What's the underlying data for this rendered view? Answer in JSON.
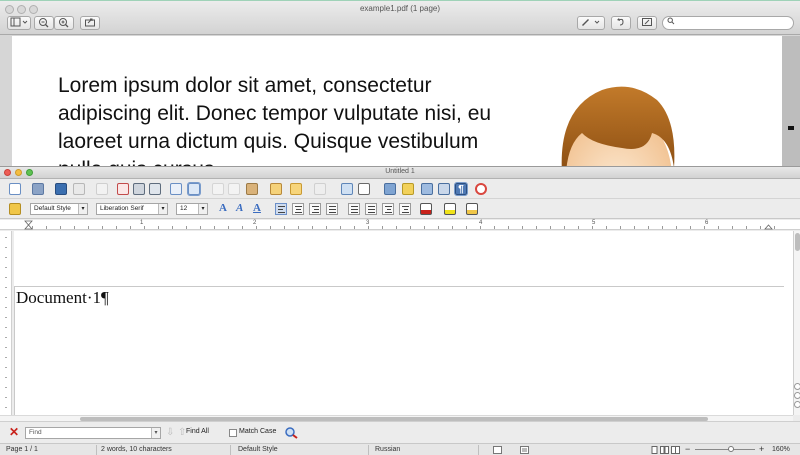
{
  "preview": {
    "title": "example1.pdf (1 page)",
    "search_placeholder": "",
    "body_text": "Lorem ipsum dolor sit amet, consectetur adipiscing elit. Donec tempor vulputate nisi, eu laoreet urna dictum quis. Quisque vestibulum nulla quis cursus"
  },
  "writer": {
    "title": "Untitled 1",
    "style_box": "Default Style",
    "font_box": "Liberation Serif",
    "size_box": "12",
    "ruler_numbers": [
      "1",
      "2",
      "3",
      "4",
      "5",
      "6"
    ],
    "document_text": "Document·1¶",
    "find": {
      "placeholder": "Find",
      "find_all": "Find All",
      "match_case": "Match Case"
    },
    "status": {
      "page": "Page 1 / 1",
      "words": "2 words, 10 characters",
      "style": "Default Style",
      "language": "Russian",
      "zoom": "160%"
    }
  },
  "colors": {
    "close": "#ee5d55",
    "minimize": "#f4bd40",
    "maximize": "#5fc153",
    "accent": "#3a6cc0"
  }
}
